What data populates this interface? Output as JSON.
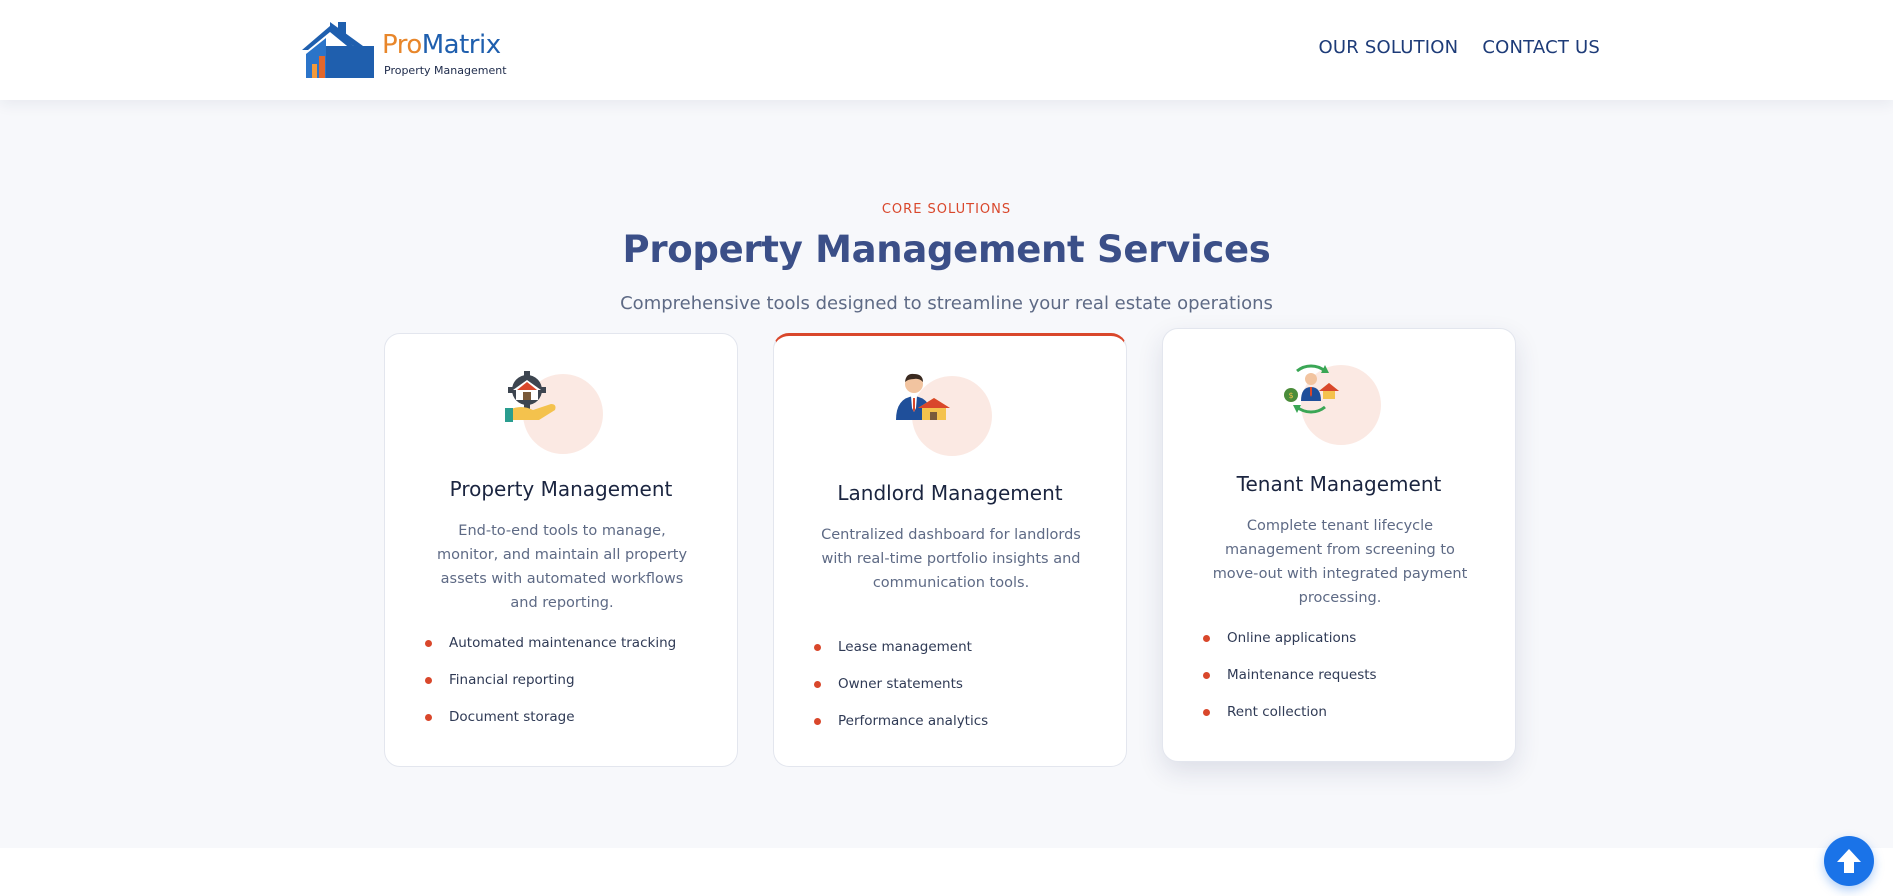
{
  "header": {
    "brand_pro": "Pro",
    "brand_matrix": "Matrix",
    "brand_tagline": "Property Management",
    "nav": [
      "OUR SOLUTION",
      "CONTACT US"
    ]
  },
  "section": {
    "eyebrow": "CORE SOLUTIONS",
    "title": "Property Management Services",
    "subtitle": "Comprehensive tools designed to streamline your real estate operations"
  },
  "cards": [
    {
      "icon": "property-management-icon",
      "title": "Property Management",
      "description": "End-to-end tools to manage, monitor, and maintain all property assets with automated workflows and reporting.",
      "features": [
        "Automated maintenance tracking",
        "Financial reporting",
        "Document storage"
      ]
    },
    {
      "icon": "landlord-icon",
      "title": "Landlord Management",
      "description": "Centralized dashboard for landlords with real-time portfolio insights and communication tools.",
      "features": [
        "Lease management",
        "Owner statements",
        "Performance analytics"
      ]
    },
    {
      "icon": "tenant-cycle-icon",
      "title": "Tenant Management",
      "description": "Complete tenant lifecycle management from screening to move-out with integrated payment processing.",
      "features": [
        "Online applications",
        "Maintenance requests",
        "Rent collection"
      ]
    }
  ],
  "colors": {
    "accent": "#d9472b",
    "heading": "#3b4f88",
    "nav": "#1d3b78",
    "icon_bg": "#fbe9e3",
    "scroll_button": "#1a73e8"
  },
  "scroll_top_icon": "arrow-up-icon"
}
